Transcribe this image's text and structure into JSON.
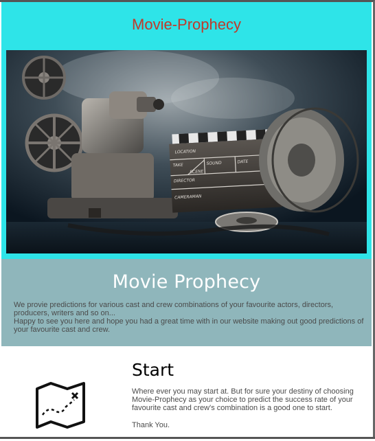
{
  "header": {
    "title": "Movie-Prophecy"
  },
  "hero": {
    "clapper_labels": {
      "location": "LOCATION",
      "take": "TAKE",
      "sound": "SOUND",
      "date": "DATE",
      "scene": "SCENE",
      "director": "DIRECTOR",
      "cameraman": "CAMERAMAN"
    }
  },
  "about": {
    "title": "Movie Prophecy",
    "line1": "We provie predictions for various cast and crew combinations of your favourite actors, directors, producers, writers and so on...",
    "line2": "Happy to see you here and hope you had a great time with in our website making out good predictions of your favourite cast and crew."
  },
  "start": {
    "title": "Start",
    "text": "Where ever you may start at. But for sure your destiny of choosing Movie-Prophecy as your choice to predict the success rate of your favourite cast and crew's combination is a good one to start.",
    "thanks": "Thank You.",
    "icon": "treasure-map-icon"
  },
  "colors": {
    "header_bg": "#2ee4e8",
    "header_title": "#c0392b",
    "about_bg": "#8fb6bb"
  }
}
